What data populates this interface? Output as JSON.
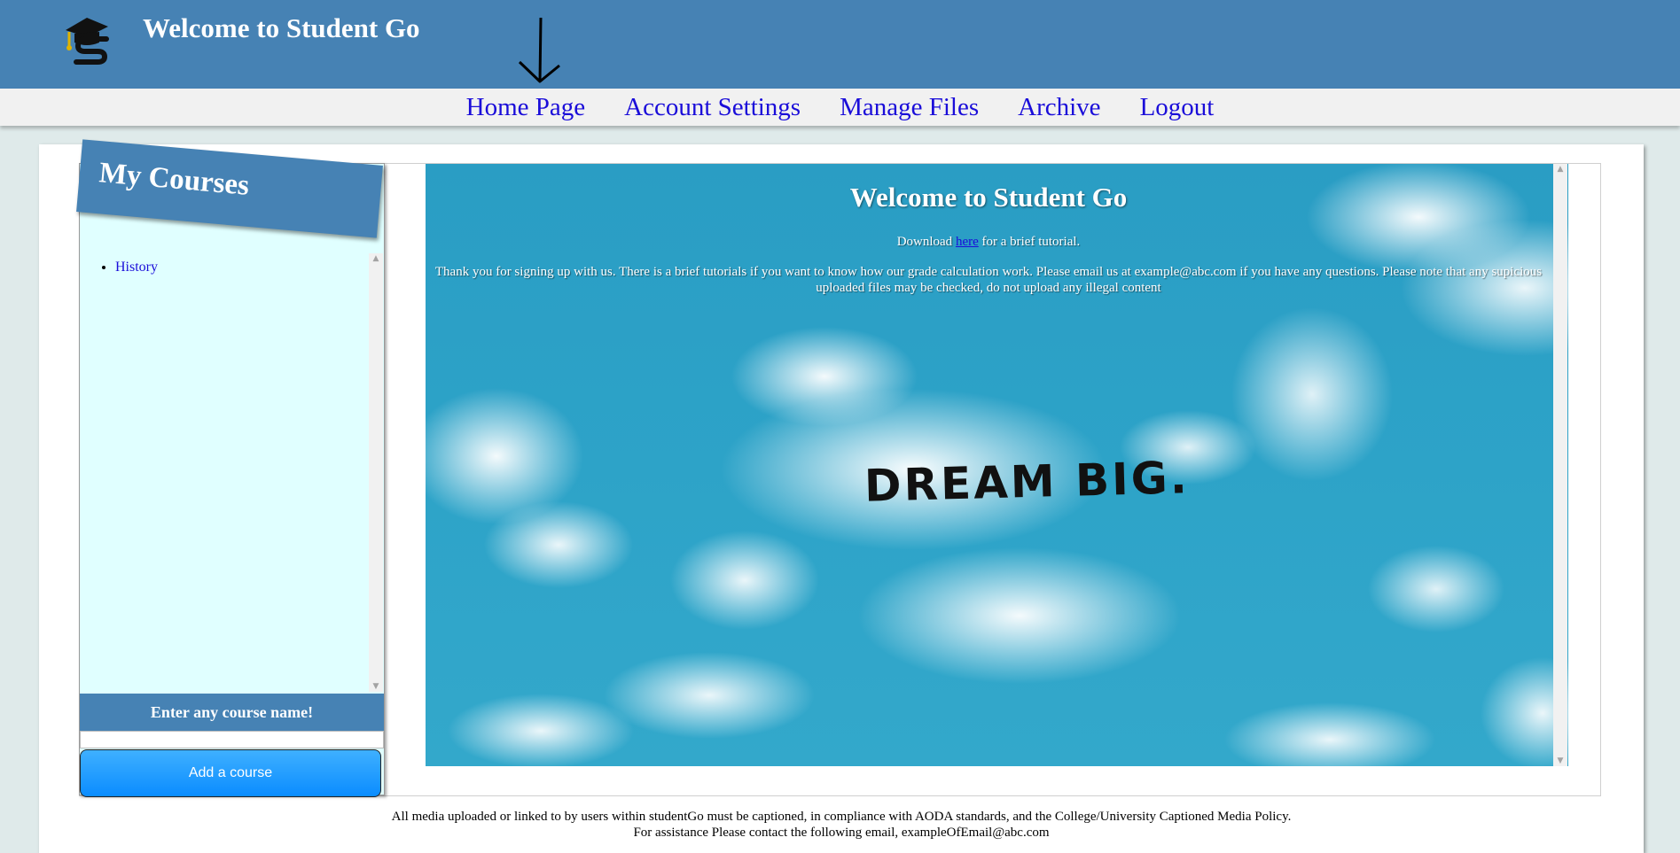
{
  "header": {
    "title": "Welcome to Student Go",
    "logo_icon": "graduation-cap-s-logo-icon",
    "annotation_icon": "down-arrow-icon"
  },
  "nav": {
    "items": [
      "Home Page",
      "Account Settings",
      "Manage Files",
      "Archive",
      "Logout"
    ]
  },
  "sidebar": {
    "title": "My Courses",
    "courses": [
      "History"
    ],
    "enter_label": "Enter any course name!",
    "input_value": "",
    "add_button": "Add a course"
  },
  "welcome": {
    "title": "Welcome to Student Go",
    "download_prefix": "Download ",
    "download_link": "here",
    "download_suffix": " for a brief tutorial.",
    "message": "Thank you for signing up with us. There is a brief tutorials if you want to know how our grade calculation work. Please email us at example@abc.com if you have any questions. Please note that any supicious uploaded files may be checked, do not upload any illegal content",
    "image_text": "DREAM BIG."
  },
  "footer": {
    "line1": "All media uploaded or linked to by users within studentGo must be captioned, in compliance with AODA standards, and the College/University Captioned Media Policy.",
    "line2": "For assistance Please contact the following email, exampleOfEmail@abc.com"
  },
  "colors": {
    "header_bg": "#4682b4",
    "nav_link": "#1a0dd9",
    "sidebar_bg": "#e0ffff",
    "button_blue": "#1e9bff"
  }
}
